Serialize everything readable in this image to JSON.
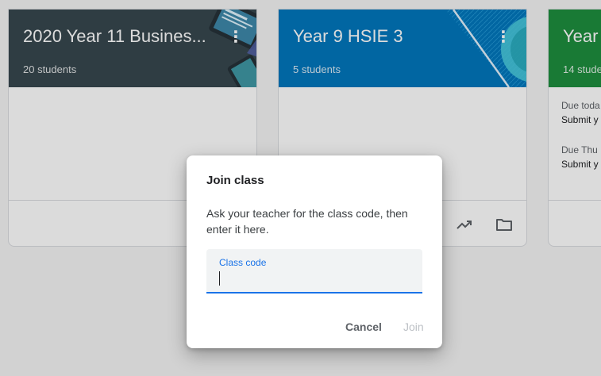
{
  "classes": [
    {
      "title": "2020 Year 11 Busines...",
      "students": "20 students",
      "color": "#37474f"
    },
    {
      "title": "Year 9 HSIE 3",
      "students": "5 students",
      "color": "#0277bd"
    },
    {
      "title": "Year",
      "students": "14 stude",
      "color": "#1e8e3e",
      "due": [
        {
          "when": "Due toda",
          "item": "Submit y"
        },
        {
          "when": "Due Thu",
          "item": "Submit y"
        }
      ]
    }
  ],
  "dialog": {
    "title": "Join class",
    "body": "Ask your teacher for the class code, then enter it here.",
    "field_label": "Class code",
    "field_value": "",
    "cancel_label": "Cancel",
    "join_label": "Join"
  },
  "colors": {
    "accent": "#1a73e8",
    "disabled": "#bdc1c6"
  },
  "icons": {
    "overflow_menu": "more-vert-icon",
    "trending": "trending-up-icon",
    "folder": "folder-icon"
  }
}
